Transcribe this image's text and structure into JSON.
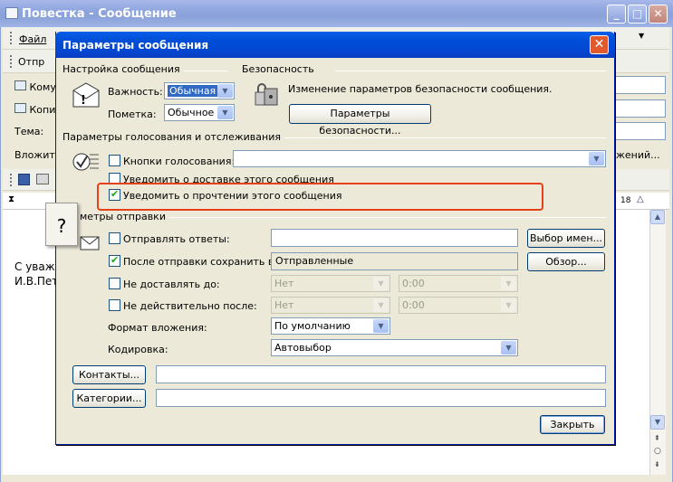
{
  "window": {
    "title": "Повестка - Сообщение"
  },
  "menu": {
    "file": "Файл"
  },
  "toolbar": {
    "send_label": "Отпр"
  },
  "header_fields": {
    "to": "Кому",
    "cc": "Копи",
    "subject": "Тема:",
    "attach": "Вложить",
    "attach_right": "жений..."
  },
  "ruler": {
    "tick_18": "18"
  },
  "message_body": {
    "line1": "С уваж",
    "line2": "И.В.Пет"
  },
  "dialog": {
    "title": "Параметры сообщения",
    "close_label": "✕",
    "group_message_settings": "Настройка сообщения",
    "importance_label": "Важность:",
    "importance_value": "Обычная",
    "sensitivity_label": "Пометка:",
    "sensitivity_value": "Обычное",
    "group_security": "Безопасность",
    "security_text": "Изменение параметров безопасности сообщения.",
    "security_button": "Параметры безопасности...",
    "group_voting": "Параметры голосования и отслеживания",
    "voting_buttons_label": "Кнопки голосования:",
    "delivery_receipt_label": "Уведомить о доставке этого сообщения",
    "read_receipt_label": "Уведомить о прочтении этого сообщения",
    "group_delivery": "метры отправки",
    "replies_label": "Отправлять ответы:",
    "select_names_button": "Выбор имен...",
    "save_sent_label": "После отправки сохранить в:",
    "save_sent_value": "Отправленные",
    "browse_button": "Обзор...",
    "do_not_deliver_label": "Не доставлять до:",
    "do_not_deliver_date": "Нет",
    "do_not_deliver_time": "0:00",
    "expires_label": "Не действительно после:",
    "expires_date": "Нет",
    "expires_time": "0:00",
    "attachment_format_label": "Формат вложения:",
    "attachment_format_value": "По умолчанию",
    "encoding_label": "Кодировка:",
    "encoding_value": "Автовыбор",
    "contacts_button": "Контакты...",
    "categories_button": "Категории...",
    "close_button": "Закрыть"
  },
  "callout": {
    "text": "?"
  },
  "checkbox_states": {
    "voting": false,
    "delivery": false,
    "read": true,
    "replies": false,
    "save_sent": true,
    "do_not_deliver": false,
    "expires": false
  },
  "colors": {
    "dialog_title": "#0050d8",
    "highlight": "#e6421a",
    "check": "#21a121"
  }
}
